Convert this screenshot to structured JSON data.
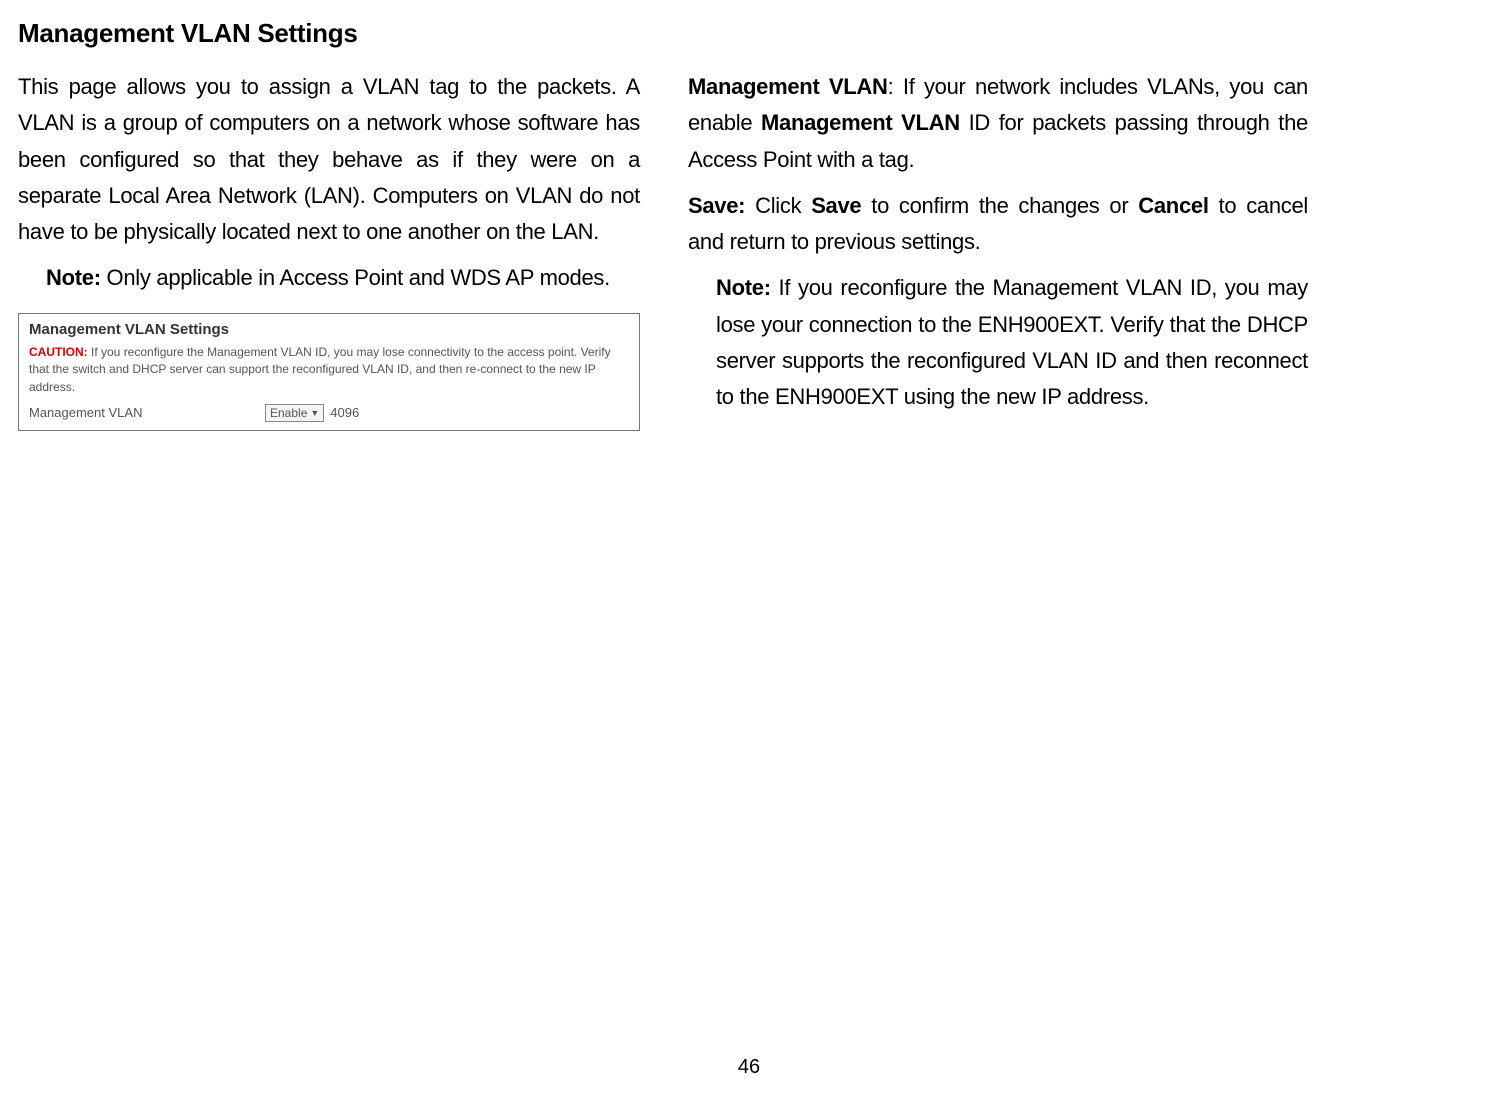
{
  "heading": "Management VLAN Settings",
  "left": {
    "intro": "This page allows you to assign a VLAN tag to the packets. A VLAN is a group of computers on a network whose software has been configured so that they behave as if they were on a separate Local Area Network (LAN). Computers on VLAN do not have to be physically located next to one another on the LAN.",
    "note_label": "Note:",
    "note_text": " Only applicable in Access Point and WDS AP modes.",
    "panel": {
      "title": "Management VLAN Settings",
      "caution_label": "CAUTION:",
      "caution_text": " If you reconfigure the Management VLAN ID, you may lose connectivity to the access point. Verify that the switch and DHCP server can support the reconfigured VLAN ID, and then re-connect to the new IP address.",
      "setting_label": "Management VLAN",
      "select_value": "Enable",
      "vlan_id": "4096"
    }
  },
  "right": {
    "mvlan_label": "Management VLAN",
    "mvlan_text_pre": ": If your network includes VLANs, you can enable ",
    "mvlan_bold": "Management VLAN",
    "mvlan_text_post": " ID for packets passing through the Access Point with a tag.",
    "save_label": "Save:",
    "save_pre": " Click ",
    "save_bold1": "Save",
    "save_mid": " to confirm the changes or ",
    "save_bold2": "Cancel",
    "save_post": " to cancel and return to previous settings.",
    "note_label": "Note:",
    "note_text": " If you reconfigure the Management VLAN ID, you may lose your connection to the ENH900EXT. Verify that the DHCP server supports the reconfigured VLAN ID and then reconnect to the ENH900EXT using the new IP address."
  },
  "page_number": "46"
}
